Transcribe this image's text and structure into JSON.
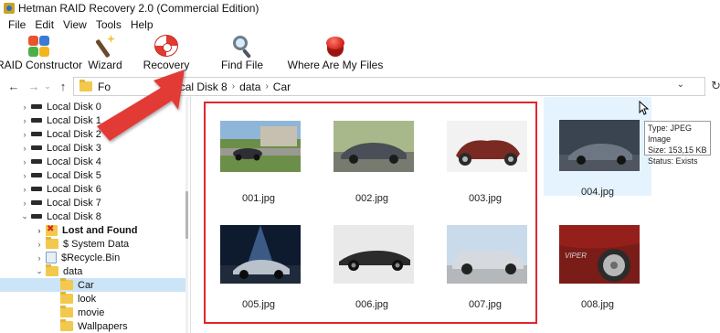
{
  "window": {
    "title": "Hetman RAID Recovery 2.0 (Commercial Edition)"
  },
  "menu": [
    "File",
    "Edit",
    "View",
    "Tools",
    "Help"
  ],
  "toolbar": {
    "buttons": [
      {
        "label": "RAID Constructor",
        "icon": "puzzle-icon"
      },
      {
        "label": "Wizard",
        "icon": "wand-icon"
      },
      {
        "label": "Recovery",
        "icon": "lifebuoy-icon"
      },
      {
        "label": "Find File",
        "icon": "magnifier-icon"
      },
      {
        "label": "Where Are My Files",
        "icon": "red-button-icon"
      }
    ]
  },
  "address": {
    "crumbs": [
      "Fo",
      "Local Disk 8",
      "data",
      "Car"
    ]
  },
  "tree": {
    "disks": [
      "Local Disk 0",
      "Local Disk 1",
      "Local Disk 2",
      "Local Disk 3",
      "Local Disk 4",
      "Local Disk 5",
      "Local Disk 6",
      "Local Disk 7",
      "Local Disk 8"
    ],
    "disk8_children": [
      "Lost and Found",
      "$ System Data",
      "$Recycle.Bin",
      "data"
    ],
    "data_children": [
      "Car",
      "look",
      "movie",
      "Wallpapers"
    ],
    "selected": "Car"
  },
  "files": [
    {
      "name": "001.jpg"
    },
    {
      "name": "002.jpg"
    },
    {
      "name": "003.jpg"
    },
    {
      "name": "004.jpg"
    },
    {
      "name": "005.jpg"
    },
    {
      "name": "006.jpg"
    },
    {
      "name": "007.jpg"
    },
    {
      "name": "008.jpg"
    }
  ],
  "tooltip": {
    "type": "Type: JPEG Image",
    "size": "Size: 153,15 KB",
    "status": "Status: Exists"
  },
  "colors": {
    "highlight": "#e0262b",
    "arrow": "#e23a34",
    "selection": "#cce4f7",
    "hover": "#e5f3ff"
  }
}
